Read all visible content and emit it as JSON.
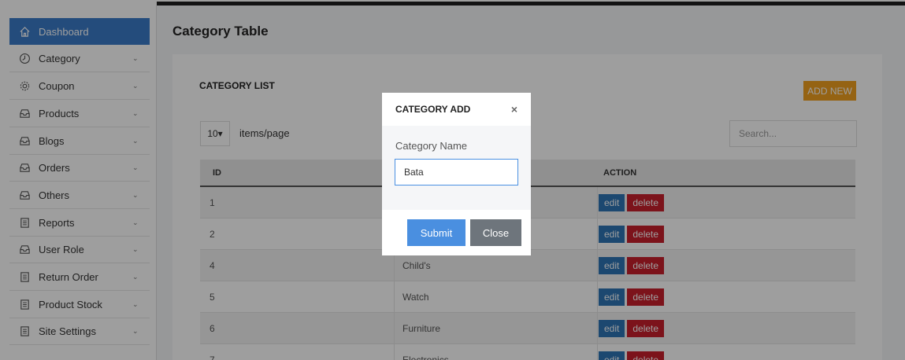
{
  "sidebar": {
    "items": [
      {
        "label": "Dashboard",
        "icon": "home-icon",
        "active": true
      },
      {
        "label": "Category",
        "icon": "clock-icon"
      },
      {
        "label": "Coupon",
        "icon": "gear-icon"
      },
      {
        "label": "Products",
        "icon": "inbox-icon"
      },
      {
        "label": "Blogs",
        "icon": "inbox-icon"
      },
      {
        "label": "Orders",
        "icon": "inbox-icon"
      },
      {
        "label": "Others",
        "icon": "inbox-icon"
      },
      {
        "label": "Reports",
        "icon": "clipboard-icon"
      },
      {
        "label": "User Role",
        "icon": "inbox-icon"
      },
      {
        "label": "Return Order",
        "icon": "clipboard-icon"
      },
      {
        "label": "Product Stock",
        "icon": "clipboard-icon"
      },
      {
        "label": "Site Settings",
        "icon": "clipboard-icon"
      }
    ],
    "chevron": "⌄"
  },
  "main": {
    "title": "Category Table",
    "card": {
      "title": "CATEGORY LIST",
      "add_new_label": "ADD NEW",
      "per_page_value": "10▾",
      "per_page_label": "items/page",
      "search_placeholder": "Search..."
    },
    "table": {
      "headers": {
        "id": "ID",
        "name": "",
        "action": "ACTION"
      },
      "rows": [
        {
          "id": "1",
          "name": ""
        },
        {
          "id": "2",
          "name": ""
        },
        {
          "id": "4",
          "name": "Child's"
        },
        {
          "id": "5",
          "name": "Watch"
        },
        {
          "id": "6",
          "name": "Furniture"
        },
        {
          "id": "7",
          "name": "Electronics"
        }
      ],
      "edit_label": "edit",
      "delete_label": "delete"
    }
  },
  "modal": {
    "title": "CATEGORY ADD",
    "close_symbol": "×",
    "field_label": "Category Name",
    "field_value": "Bata",
    "submit_label": "Submit",
    "close_label": "Close"
  },
  "colors": {
    "sidebar_active": "#3a7bc8",
    "add_new": "#f0a020",
    "edit": "#2e74b5",
    "delete": "#c8202c",
    "submit": "#4a8fe0",
    "close": "#6e757c"
  }
}
